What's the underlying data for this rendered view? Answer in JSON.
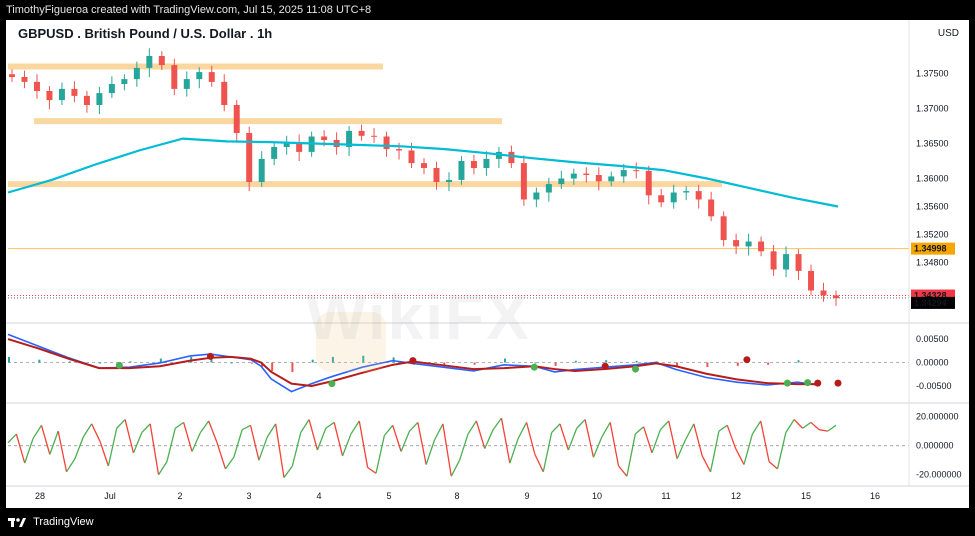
{
  "header": {
    "attribution": "TimothyFigueroa created with TradingView.com, Jul 15, 2025 11:08 UTC+8",
    "title": "GBPUSD . British Pound / U.S. Dollar . 1h",
    "currency": "USD"
  },
  "footer": {
    "brand": "TradingView"
  },
  "watermark": {
    "text": "WikiFX"
  },
  "colors": {
    "up_candle": "#26a69a",
    "down_candle": "#ef5350",
    "ma_line": "#00bcd4",
    "zone_fill": "#fbd7a0",
    "level_line": "#f7c35f",
    "macd_line": "#2962ff",
    "signal_line": "#b71c1c",
    "osc_up": "#4caf50",
    "osc_down": "#f44336"
  },
  "chart_data": [
    {
      "type": "line",
      "name": "price",
      "title": "GBPUSD . British Pound / U.S. Dollar . 1h",
      "ylim": [
        1.3395,
        1.3795
      ],
      "y_ticks": [
        "1.37500",
        "1.37000",
        "1.36500",
        "1.36000",
        "1.35600",
        "1.35200",
        "1.34800"
      ],
      "x_ticks": [
        "28",
        "Jul",
        "2",
        "3",
        "4",
        "5",
        "8",
        "9",
        "10",
        "11",
        "12",
        "15",
        "16"
      ],
      "close": [
        1.3745,
        1.3738,
        1.3725,
        1.3712,
        1.3728,
        1.3718,
        1.3705,
        1.3722,
        1.3735,
        1.3742,
        1.3758,
        1.3775,
        1.3762,
        1.3728,
        1.3742,
        1.3752,
        1.3738,
        1.3705,
        1.3665,
        1.3595,
        1.3628,
        1.3645,
        1.3652,
        1.3638,
        1.366,
        1.3655,
        1.3645,
        1.3668,
        1.3661,
        1.366,
        1.3642,
        1.364,
        1.3622,
        1.3615,
        1.3595,
        1.3598,
        1.3625,
        1.3615,
        1.3628,
        1.3638,
        1.3622,
        1.357,
        1.358,
        1.3592,
        1.36,
        1.3607,
        1.3605,
        1.3596,
        1.3603,
        1.3612,
        1.3611,
        1.3576,
        1.3566,
        1.358,
        1.3582,
        1.357,
        1.3546,
        1.3512,
        1.3503,
        1.351,
        1.3496,
        1.347,
        1.3492,
        1.3468,
        1.344,
        1.3433,
        1.3429
      ],
      "ma": [
        1.358,
        1.3598,
        1.362,
        1.364,
        1.3657,
        1.3653,
        1.3652,
        1.365,
        1.3648,
        1.3646,
        1.3642,
        1.3636,
        1.3629,
        1.3623,
        1.3618,
        1.3612,
        1.36,
        1.3586,
        1.3572,
        1.356
      ],
      "zones": [
        1.376,
        1.3682,
        1.3592
      ],
      "level": 1.34998,
      "price_tags": [
        {
          "label": "1.34998",
          "value": 1.34998,
          "bg": "#f7a600",
          "fg": "#000000"
        },
        {
          "label": "1.34328",
          "value": 1.34328,
          "bg": "#f23645",
          "fg": "#ffffff"
        },
        {
          "label": "1.34294",
          "value": 1.34294,
          "bg": "#000000",
          "fg": "#ffffff"
        }
      ]
    },
    {
      "type": "line",
      "name": "macd",
      "ylim": [
        -0.008,
        0.008
      ],
      "y_ticks": [
        "0.00500",
        "0.00000",
        "-0.00500"
      ],
      "x_range": [
        0,
        67
      ],
      "macd": [
        [
          0,
          0.006
        ],
        [
          3,
          0.0035
        ],
        [
          6,
          0.001
        ],
        [
          9,
          -0.0012
        ],
        [
          12,
          -0.001
        ],
        [
          15,
          -0.0001
        ],
        [
          18,
          0.0014
        ],
        [
          20,
          0.0018
        ],
        [
          22,
          0.0012
        ],
        [
          24,
          0.0006
        ],
        [
          25,
          -0.0008
        ],
        [
          26,
          -0.0035
        ],
        [
          28,
          -0.0062
        ],
        [
          30,
          -0.0045
        ],
        [
          32,
          -0.003
        ],
        [
          35,
          -0.001
        ],
        [
          38,
          0.0004
        ],
        [
          40,
          -0.0002
        ],
        [
          43,
          -0.001
        ],
        [
          46,
          -0.0018
        ],
        [
          49,
          -0.0005
        ],
        [
          52,
          -0.0008
        ],
        [
          54,
          -0.002
        ],
        [
          56,
          -0.0015
        ],
        [
          59,
          -0.001
        ],
        [
          62,
          -0.0005
        ],
        [
          64,
          0.0
        ],
        [
          66,
          -0.0015
        ],
        [
          69,
          -0.0032
        ],
        [
          72,
          -0.0042
        ],
        [
          75,
          -0.0048
        ],
        [
          78,
          -0.0042
        ],
        [
          80,
          -0.0048
        ]
      ],
      "signal": [
        [
          0,
          0.005
        ],
        [
          3,
          0.003
        ],
        [
          6,
          0.0008
        ],
        [
          9,
          -0.0012
        ],
        [
          12,
          -0.0012
        ],
        [
          15,
          -0.0008
        ],
        [
          18,
          0.0004
        ],
        [
          20,
          0.001
        ],
        [
          22,
          0.0012
        ],
        [
          24,
          0.0008
        ],
        [
          25,
          0.0
        ],
        [
          26,
          -0.002
        ],
        [
          28,
          -0.0045
        ],
        [
          30,
          -0.005
        ],
        [
          32,
          -0.004
        ],
        [
          35,
          -0.0022
        ],
        [
          38,
          -0.0005
        ],
        [
          40,
          0.0002
        ],
        [
          43,
          -0.0006
        ],
        [
          46,
          -0.0014
        ],
        [
          49,
          -0.0012
        ],
        [
          52,
          -0.0008
        ],
        [
          54,
          -0.0014
        ],
        [
          56,
          -0.0018
        ],
        [
          59,
          -0.0014
        ],
        [
          62,
          -0.0008
        ],
        [
          64,
          -0.0002
        ],
        [
          66,
          -0.0008
        ],
        [
          69,
          -0.0024
        ],
        [
          72,
          -0.0036
        ],
        [
          75,
          -0.0044
        ],
        [
          78,
          -0.0046
        ],
        [
          80,
          -0.0046
        ]
      ],
      "cross_up": [
        [
          11,
          -0.0006
        ],
        [
          32,
          -0.0045
        ],
        [
          52,
          -0.001
        ],
        [
          62,
          -0.0014
        ],
        [
          77,
          -0.0044
        ],
        [
          79,
          -0.0043
        ]
      ],
      "cross_down": [
        [
          20,
          0.0013
        ],
        [
          40,
          0.0004
        ],
        [
          59,
          -0.0008
        ],
        [
          73,
          0.0006
        ],
        [
          80,
          -0.0044
        ],
        [
          82,
          -0.0044
        ]
      ]
    },
    {
      "type": "line",
      "name": "oscillator",
      "ylim": [
        -25,
        28
      ],
      "y_ticks": [
        "20.000000",
        "0.000000",
        "-20.000000"
      ],
      "x_range": [
        0,
        100
      ],
      "values": [
        2,
        8,
        -12,
        5,
        14,
        -6,
        10,
        -18,
        -9,
        6,
        15,
        3,
        -14,
        12,
        18,
        -5,
        9,
        15,
        -20,
        -11,
        12,
        16,
        -4,
        9,
        17,
        2,
        -16,
        -8,
        11,
        14,
        -10,
        6,
        15,
        -22,
        -14,
        9,
        18,
        -3,
        12,
        16,
        -7,
        8,
        17,
        -15,
        -19,
        7,
        14,
        -4,
        10,
        16,
        -13,
        4,
        15,
        -21,
        -10,
        8,
        17,
        -2,
        11,
        19,
        -12,
        5,
        16,
        -6,
        -18,
        9,
        15,
        -3,
        12,
        18,
        -8,
        6,
        16,
        -14,
        -21,
        8,
        13,
        -5,
        11,
        17,
        -9,
        4,
        15,
        -7,
        -18,
        10,
        14,
        -2,
        -13,
        8,
        17,
        -11,
        -16,
        9,
        18,
        12,
        16,
        11,
        10,
        14
      ]
    }
  ]
}
